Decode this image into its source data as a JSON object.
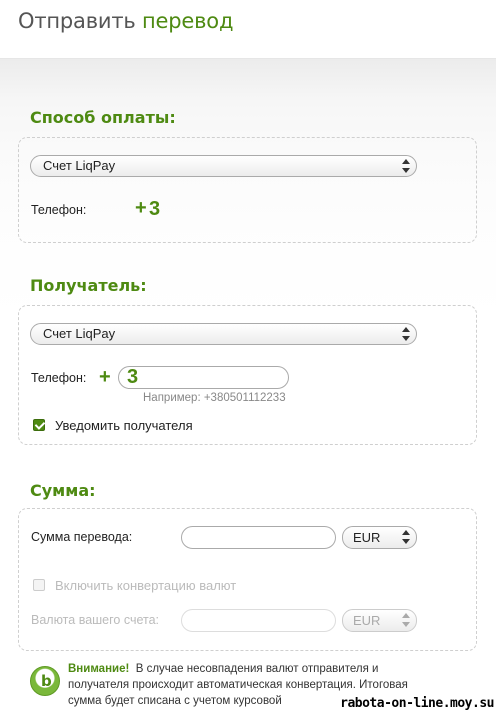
{
  "header": {
    "title_part1": "Отправить",
    "title_part2": "перевод"
  },
  "payment": {
    "section_title": "Способ оплаты:",
    "method_select": "Счет LiqPay",
    "phone_label": "Телефон:",
    "phone_plus": "+",
    "phone_code": "3"
  },
  "recipient": {
    "section_title": "Получатель:",
    "method_select": "Счет LiqPay",
    "phone_label": "Телефон:",
    "phone_plus": "+",
    "phone_code": "3",
    "phone_hint": "Например: +380501112233",
    "notify_label": "Уведомить получателя",
    "notify_checked": true
  },
  "amount": {
    "section_title": "Сумма:",
    "amount_label": "Сумма перевода:",
    "amount_value": "",
    "currency_select": "EUR",
    "conversion_label": "Включить конвертацию валют",
    "account_currency_label": "Валюта вашего счета:",
    "account_currency_value": "",
    "account_currency_select": "EUR"
  },
  "notice": {
    "title": "Внимание!",
    "text": "В случае несовпадения валют отправителя и получателя происходит автоматическая конвертация. Итоговая сумма будет списана с учетом курсовой"
  },
  "watermark": "rabota-on-line.moy.su",
  "colors": {
    "accent_green": "#4e8a12",
    "panel_border": "#cfcfcf"
  }
}
